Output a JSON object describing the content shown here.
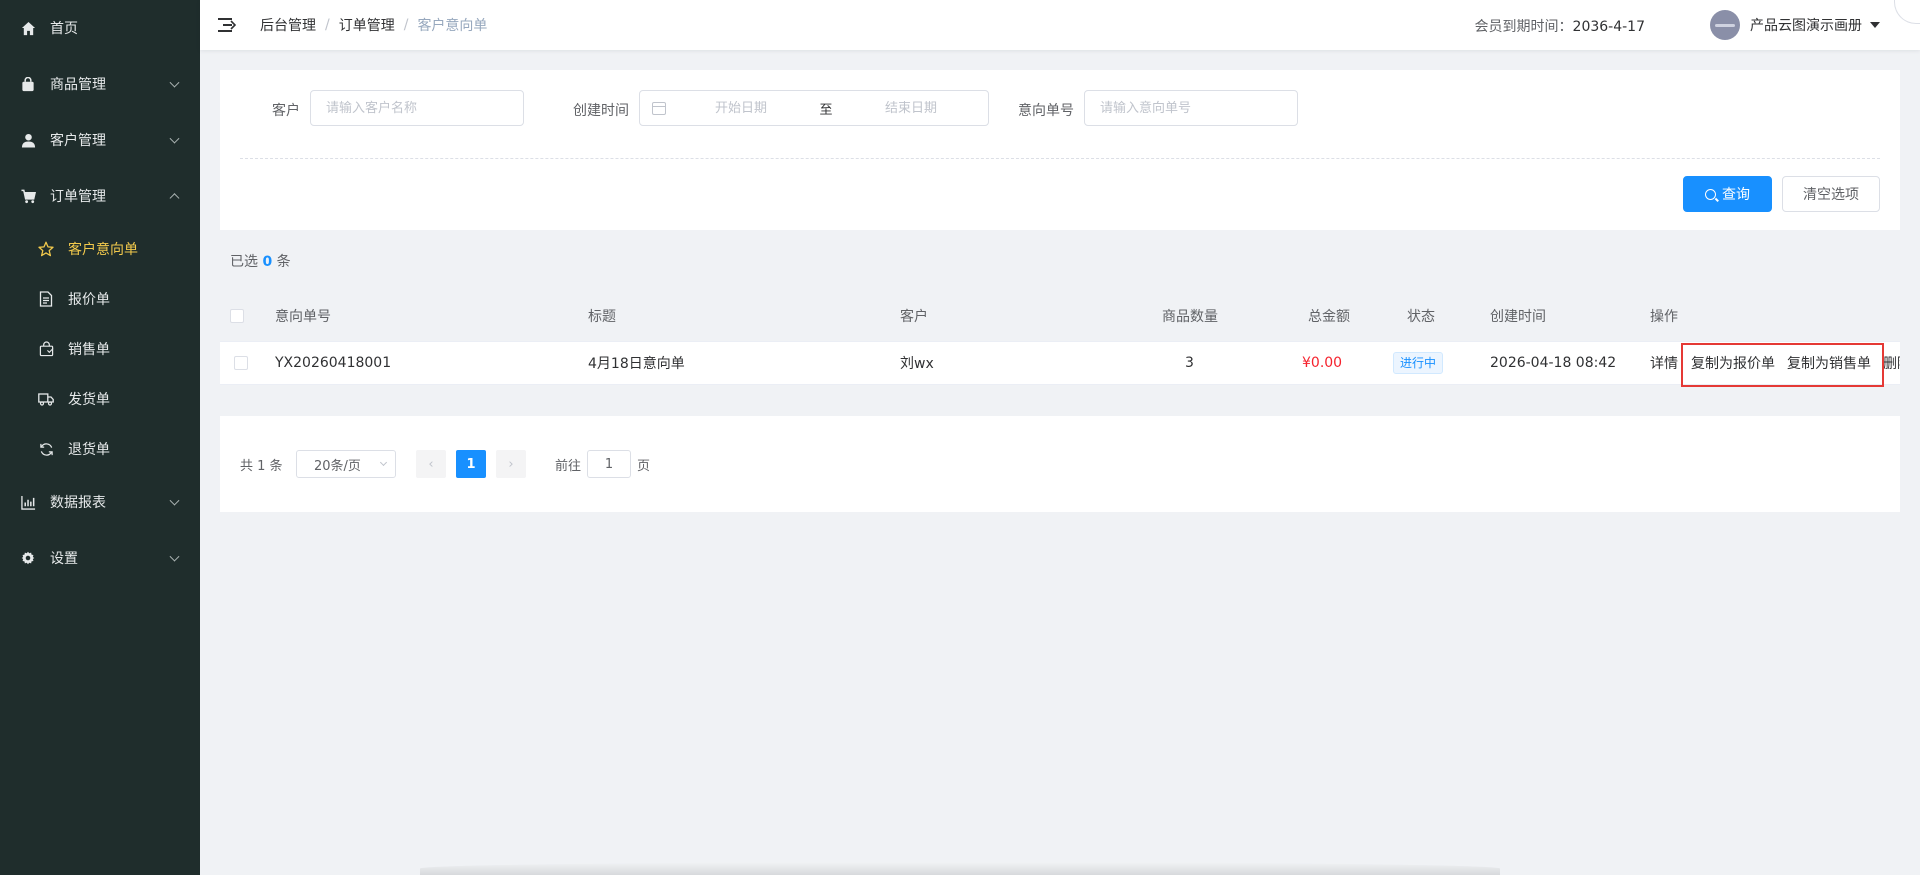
{
  "sidebar": {
    "items": [
      {
        "label": "首页",
        "icon": "home-icon",
        "has_children": false
      },
      {
        "label": "商品管理",
        "icon": "bag-icon",
        "has_children": true
      },
      {
        "label": "客户管理",
        "icon": "user-icon",
        "has_children": true
      },
      {
        "label": "订单管理",
        "icon": "cart-icon",
        "has_children": true,
        "expanded": true,
        "children": [
          {
            "label": "客户意向单",
            "icon": "star-icon",
            "active": true
          },
          {
            "label": "报价单",
            "icon": "document-icon"
          },
          {
            "label": "销售单",
            "icon": "shopping-bag-icon"
          },
          {
            "label": "发货单",
            "icon": "truck-icon"
          },
          {
            "label": "退货单",
            "icon": "refresh-icon"
          }
        ]
      },
      {
        "label": "数据报表",
        "icon": "chart-icon",
        "has_children": true
      },
      {
        "label": "设置",
        "icon": "gear-icon",
        "has_children": true
      }
    ]
  },
  "header": {
    "breadcrumb": [
      "后台管理",
      "订单管理",
      "客户意向单"
    ],
    "member_label": "会员到期时间：",
    "member_date": "2036-4-17",
    "user_name": "产品云图演示画册"
  },
  "search": {
    "customer_label": "客户",
    "customer_placeholder": "请输入客户名称",
    "created_label": "创建时间",
    "start_placeholder": "开始日期",
    "range_separator": "至",
    "end_placeholder": "结束日期",
    "order_no_label": "意向单号",
    "order_no_placeholder": "请输入意向单号",
    "query_button": "查询",
    "clear_button": "清空选项"
  },
  "selection": {
    "prefix": "已选",
    "count": "0",
    "suffix": "条"
  },
  "table": {
    "columns": [
      "意向单号",
      "标题",
      "客户",
      "商品数量",
      "总金额",
      "状态",
      "创建时间",
      "操作"
    ],
    "rows": [
      {
        "order_no": "YX20260418001",
        "title": "4月18日意向单",
        "customer": "刘wx",
        "quantity": "3",
        "amount": "¥0.00",
        "status": "进行中",
        "created": "2026-04-18 08:42",
        "actions": [
          "详情",
          "复制为报价单",
          "复制为销售单",
          "删除"
        ]
      }
    ]
  },
  "pagination": {
    "total_text": "共 1 条",
    "page_size": "20条/页",
    "prev": "‹",
    "current_page": "1",
    "next": "›",
    "goto_label": "前往",
    "goto_value": "1",
    "page_suffix": "页"
  },
  "colors": {
    "sidebar_bg": "#1f2d2c",
    "active_menu": "#f2c94c",
    "primary": "#1890ff",
    "amount": "#f5222d",
    "highlight_box": "#e53935"
  }
}
